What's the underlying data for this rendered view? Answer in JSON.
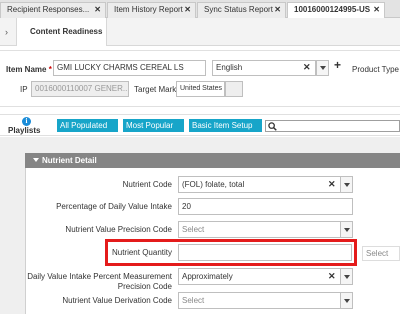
{
  "tabs": [
    {
      "label": "Recipient Responses...",
      "active": false
    },
    {
      "label": "Item History Report",
      "active": false
    },
    {
      "label": "Sync Status Report",
      "active": false
    },
    {
      "label": "10016000124995-US",
      "active": true
    }
  ],
  "subtabs": {
    "active": "Content Readiness"
  },
  "header": {
    "item_name_label": "Item Name",
    "required_mark": "*",
    "item_name_value": "GMI LUCKY CHARMS CEREAL LS",
    "language_value": "English",
    "product_type_label": "Product Type",
    "ip_label": "IP",
    "ip_value": "0016000110007 GENER...",
    "target_market_label": "Target Market",
    "target_market_value": "United States"
  },
  "playlists": {
    "label": "Playlists",
    "chips": [
      "All Populated",
      "Most Popular",
      "Basic Item Setup"
    ],
    "search_placeholder": ""
  },
  "nutrient_detail": {
    "title": "Nutrient Detail",
    "nutrient_code_label": "Nutrient Code",
    "nutrient_code_value": "(FOL) folate, total",
    "pct_daily_label": "Percentage of Daily Value Intake",
    "pct_daily_value": "20",
    "precision_code_label": "Nutrient Value Precision Code",
    "precision_code_value": "Select",
    "quantity_label": "Nutrient Quantity",
    "quantity_value": "",
    "quantity_unit_value": "Select",
    "measurement_precision_label_1": "Daily Value Intake Percent Measurement",
    "measurement_precision_label_2": "Precision Code",
    "measurement_precision_value": "Approximately",
    "derivation_code_label": "Nutrient Value Derivation Code",
    "derivation_code_value": "Select"
  },
  "colors": {
    "accent_chip": "#17a5c9",
    "highlight": "#e41b1b",
    "required": "#cc0000"
  }
}
